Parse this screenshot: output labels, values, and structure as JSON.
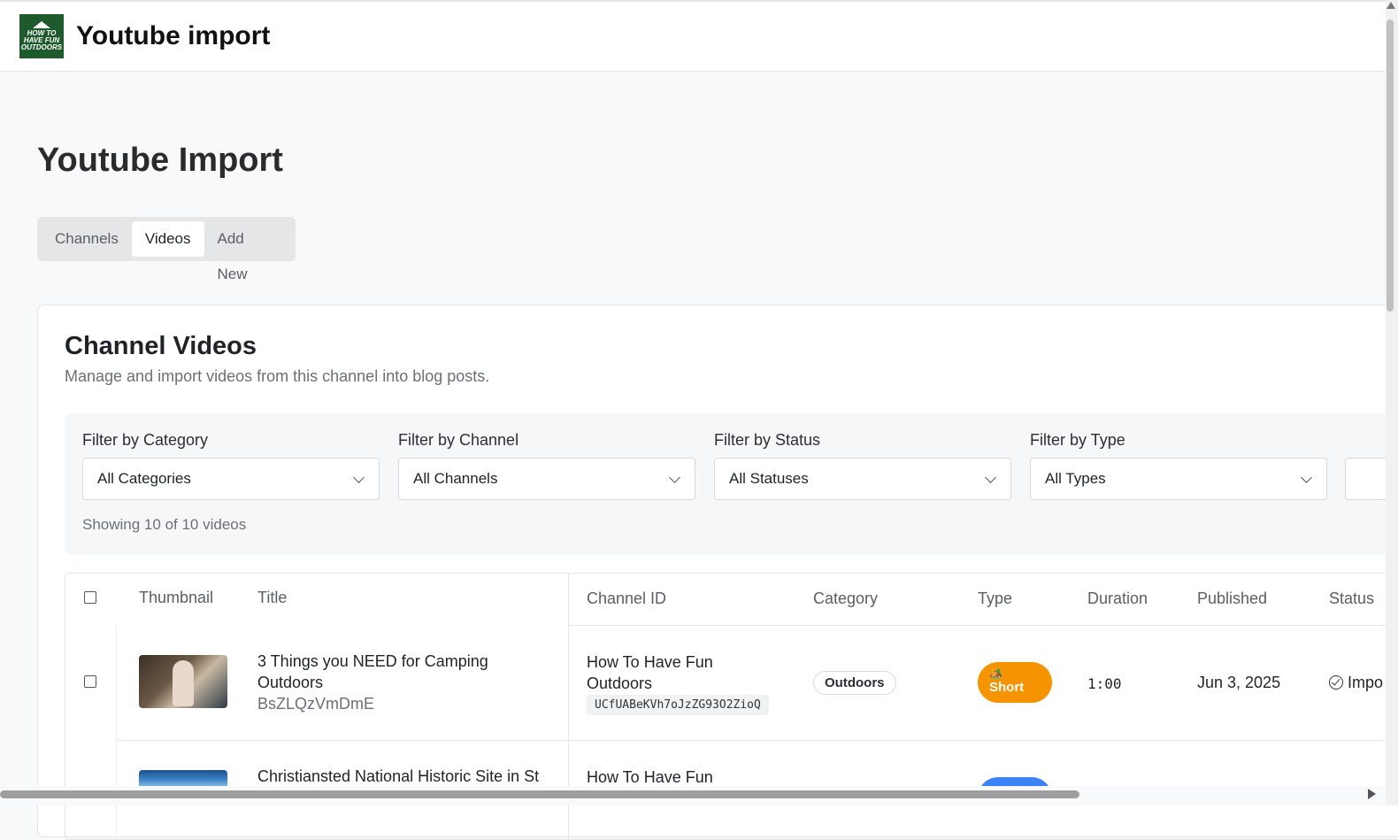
{
  "header": {
    "logo_text": "HOW TO HAVE FUN OUTDOORS",
    "app_title": "Youtube import"
  },
  "page": {
    "title": "Youtube Import"
  },
  "tabs": [
    {
      "label": "Channels",
      "active": false
    },
    {
      "label": "Videos",
      "active": true
    },
    {
      "label": "Add New",
      "active": false
    }
  ],
  "card": {
    "title": "Channel Videos",
    "subtitle": "Manage and import videos from this channel into blog posts."
  },
  "filters": {
    "category": {
      "label": "Filter by Category",
      "value": "All Categories"
    },
    "channel": {
      "label": "Filter by Channel",
      "value": "All Channels"
    },
    "status": {
      "label": "Filter by Status",
      "value": "All Statuses"
    },
    "type": {
      "label": "Filter by Type",
      "value": "All Types"
    },
    "showing": "Showing 10 of 10 videos"
  },
  "table": {
    "columns": [
      "Thumbnail",
      "Title",
      "Channel ID",
      "Category",
      "Type",
      "Duration",
      "Published",
      "Status"
    ],
    "rows": [
      {
        "title_line1": "3 Things you NEED for Camping",
        "title_line2": "Outdoors",
        "video_id": "BsZLQzVmDmE",
        "channel_line1": "How To Have Fun",
        "channel_line2": "Outdoors",
        "channel_id": "UCfUABeKVh7oJzZG93O2ZioQ",
        "category": "Outdoors",
        "type": "Short",
        "type_icon": "🏕️",
        "duration": "1:00",
        "published": "Jun 3, 2025",
        "status": "Impo"
      },
      {
        "title_line1": "Christiansted National Historic Site in St",
        "channel_line1": "How To Have Fun"
      }
    ]
  },
  "colors": {
    "short_badge": "#f59400",
    "logo_bg": "#1f5a2c"
  }
}
